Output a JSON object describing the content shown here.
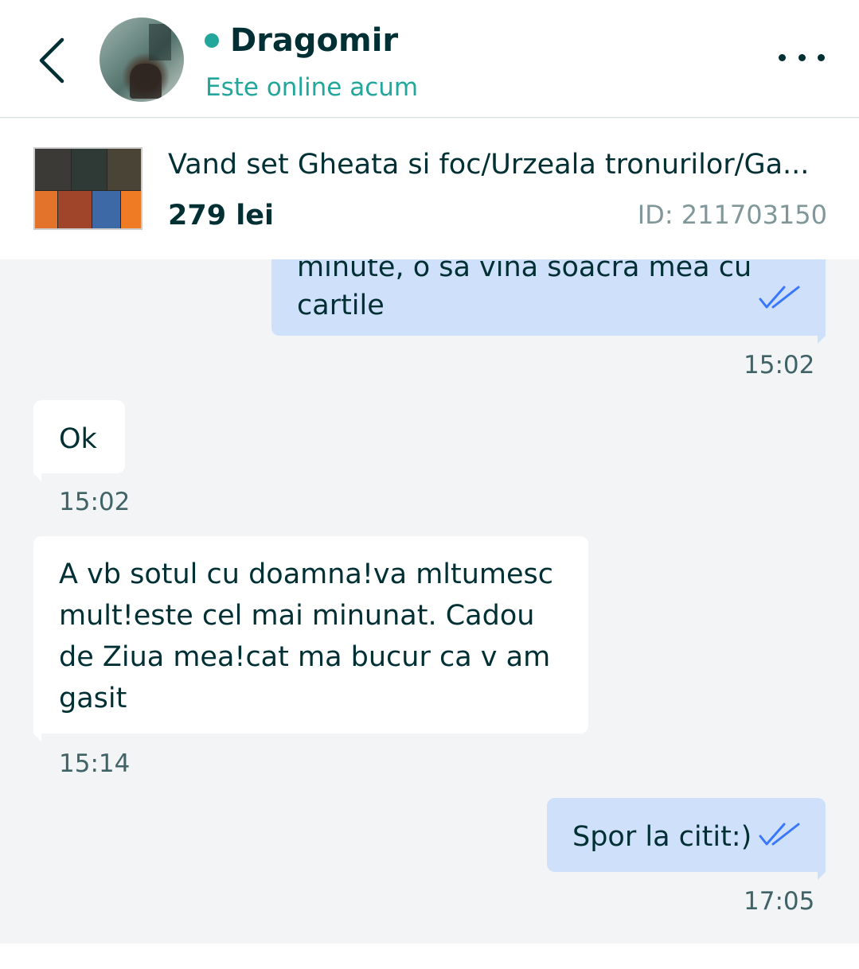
{
  "header": {
    "contact_name": "Dragomir",
    "status": "Este online acum",
    "online_color": "#23a69b",
    "back_icon": "chevron-left-icon",
    "more_icon": "more-horizontal-icon"
  },
  "ad": {
    "title": "Vand set Gheata si foc/Urzeala tronurilor/Ga...",
    "price": "279 lei",
    "id": "ID: 211703150"
  },
  "messages": [
    {
      "direction": "out",
      "lines": [
        "minute, o sa vina soacra mea cu",
        "cartile"
      ],
      "time": "15:02",
      "read": true
    },
    {
      "direction": "in",
      "lines": [
        "Ok"
      ],
      "time": "15:02"
    },
    {
      "direction": "in",
      "lines": [
        "A vb sotul cu doamna!va mltumesc",
        "mult!este cel mai minunat. Cadou",
        "de Ziua mea!cat ma bucur ca v am",
        "gasit"
      ],
      "time": "15:14"
    },
    {
      "direction": "out",
      "lines": [
        "Spor la citit:)"
      ],
      "time": "17:05",
      "read": true
    }
  ],
  "colors": {
    "outgoing_bubble": "#cfe0fb",
    "incoming_bubble": "#ffffff",
    "background": "#f2f4f5",
    "text": "#002f34",
    "read_ticks": "#3a77ff"
  }
}
